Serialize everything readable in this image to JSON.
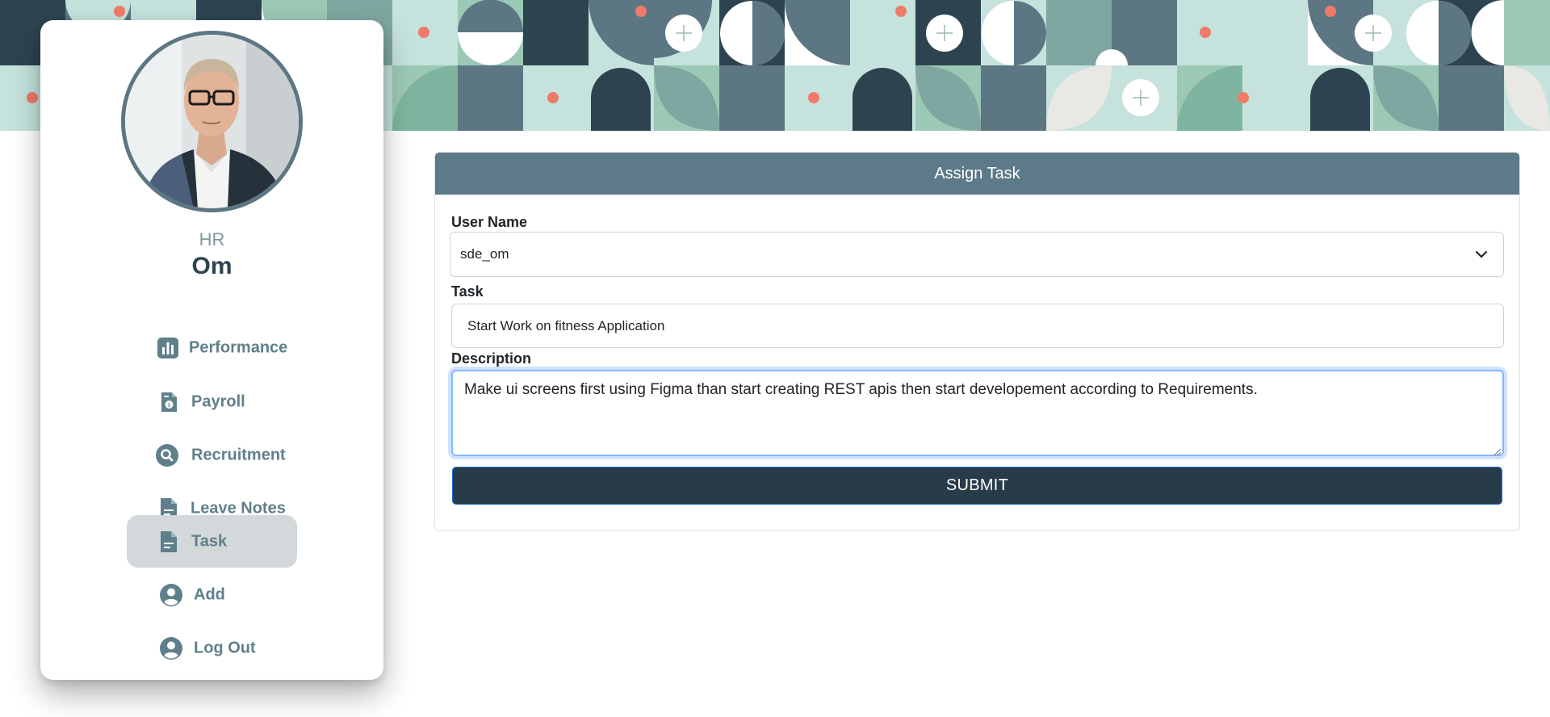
{
  "profile": {
    "role": "HR",
    "name": "Om"
  },
  "sidebar": {
    "items": [
      {
        "label": "Performance",
        "icon": "bar-chart-icon",
        "active": false
      },
      {
        "label": "Payroll",
        "icon": "payroll-icon",
        "active": false
      },
      {
        "label": "Recruitment",
        "icon": "search-icon",
        "active": false
      },
      {
        "label": "Leave Notes",
        "icon": "document-icon",
        "active": false
      },
      {
        "label": "Task",
        "icon": "document-icon",
        "active": true
      },
      {
        "label": "Add",
        "icon": "user-circle-icon",
        "active": false
      },
      {
        "label": "Log Out",
        "icon": "user-circle-icon",
        "active": false
      }
    ]
  },
  "form": {
    "title": "Assign Task",
    "username_label": "User Name",
    "username_value": "sde_om",
    "task_label": "Task",
    "task_value": "Start Work on fitness Application",
    "description_label": "Description",
    "description_value": "Make ui screens first using Figma than start creating REST apis then start developement according to Requirements.",
    "submit_label": "SUBMIT"
  },
  "colors": {
    "header": "#5c7a87",
    "submit": "#283b49",
    "nav_text": "#5f7f8b",
    "active_nav": "#d3d8db",
    "banner_dark": "#2d4450",
    "banner_mint": "#9cc8b6",
    "banner_accent": "#f07a6a"
  }
}
